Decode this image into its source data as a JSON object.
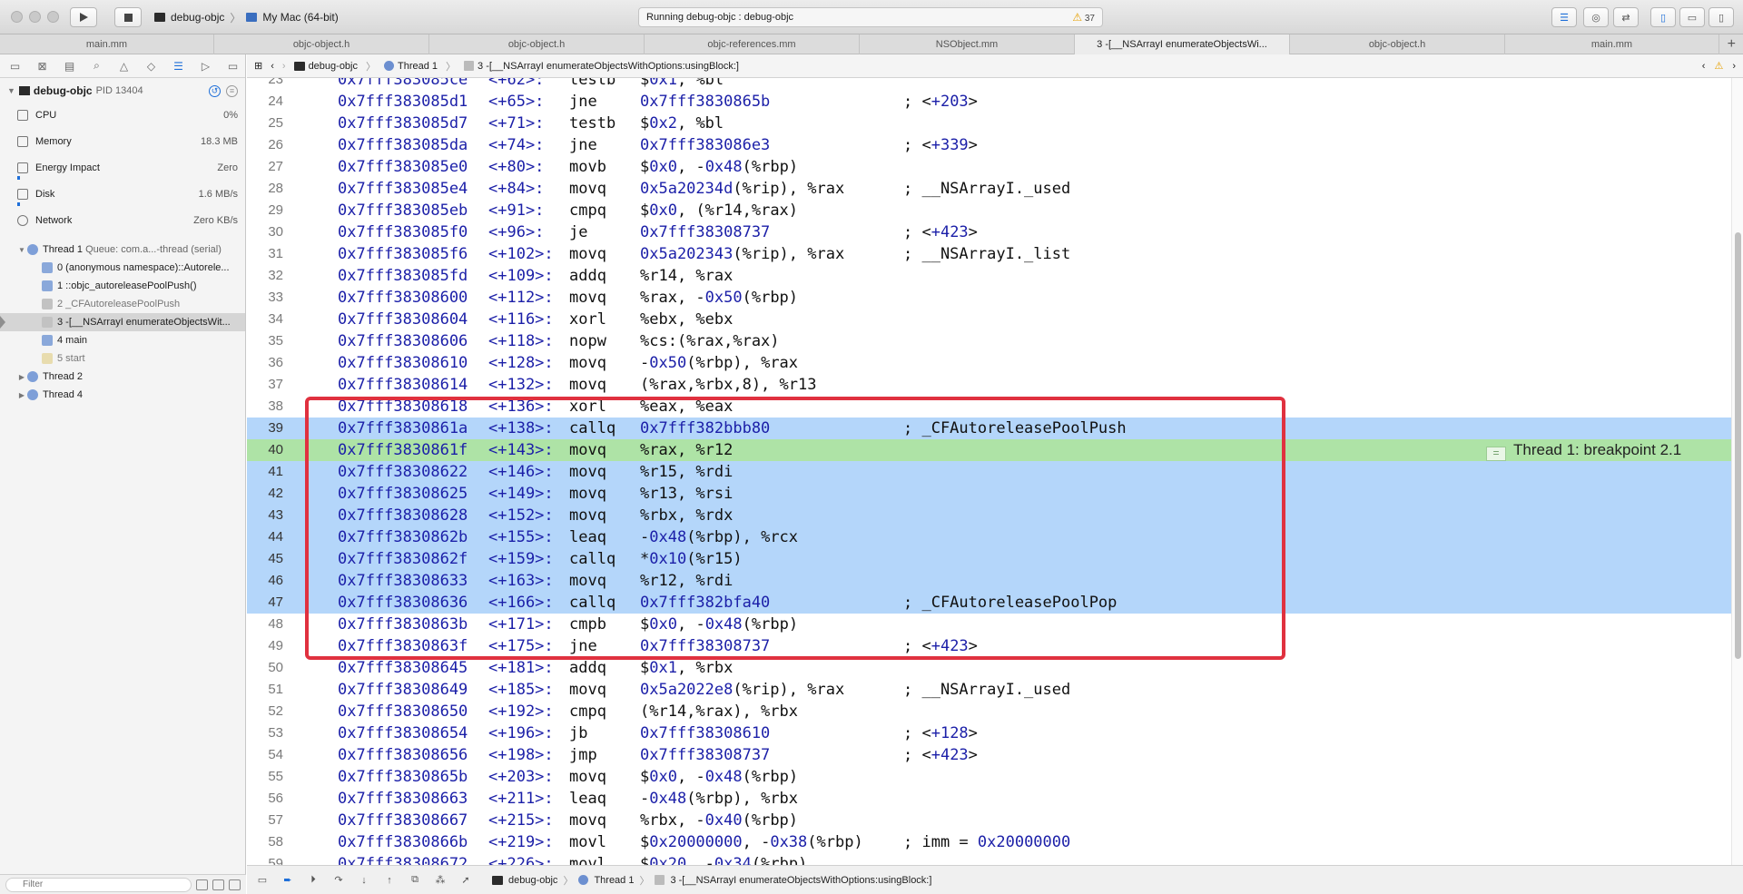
{
  "toolbar": {
    "scheme_target": "debug-objc",
    "destination": "My Mac (64-bit)",
    "status_text": "Running debug-objc : debug-objc",
    "warning_count": "37"
  },
  "tabs": [
    {
      "label": "main.mm"
    },
    {
      "label": "objc-object.h"
    },
    {
      "label": "objc-object.h"
    },
    {
      "label": "objc-references.mm"
    },
    {
      "label": "NSObject.mm"
    },
    {
      "label": "3 -[__NSArrayI enumerateObjectsWi..."
    },
    {
      "label": "objc-object.h"
    },
    {
      "label": "main.mm"
    }
  ],
  "tab_add": "+",
  "navigator": {
    "process_name": "debug-objc",
    "pid": "PID 13404",
    "gauges": [
      {
        "name": "CPU",
        "value": "0%"
      },
      {
        "name": "Memory",
        "value": "18.3 MB"
      },
      {
        "name": "Energy Impact",
        "value": "Zero"
      },
      {
        "name": "Disk",
        "value": "1.6 MB/s"
      },
      {
        "name": "Network",
        "value": "Zero KB/s"
      }
    ],
    "thread1": "Thread 1",
    "thread1_queue": "Queue: com.a...-thread (serial)",
    "frames": [
      {
        "label": "0 (anonymous namespace)::Autorele..."
      },
      {
        "label": "1 ::objc_autoreleasePoolPush()"
      },
      {
        "label": "2 _CFAutoreleasePoolPush"
      },
      {
        "label": "3 -[__NSArrayI enumerateObjectsWit..."
      },
      {
        "label": "4 main"
      },
      {
        "label": "5 start"
      }
    ],
    "thread2": "Thread 2",
    "thread4": "Thread 4",
    "filter_placeholder": "Filter"
  },
  "jumpbar": {
    "project": "debug-objc",
    "thread": "Thread 1",
    "frame": "3 -[__NSArrayI enumerateObjectsWithOptions:usingBlock:]"
  },
  "disassembly": [
    {
      "ln": "23",
      "addr": "0x7fff383085ce",
      "off": "<+62>:",
      "mn": "testb",
      "ops": "$0x1, %bl",
      "cmt": ""
    },
    {
      "ln": "24",
      "addr": "0x7fff383085d1",
      "off": "<+65>:",
      "mn": "jne",
      "ops": "0x7fff3830865b",
      "cmt": "; <+203>"
    },
    {
      "ln": "25",
      "addr": "0x7fff383085d7",
      "off": "<+71>:",
      "mn": "testb",
      "ops": "$0x2, %bl",
      "cmt": ""
    },
    {
      "ln": "26",
      "addr": "0x7fff383085da",
      "off": "<+74>:",
      "mn": "jne",
      "ops": "0x7fff383086e3",
      "cmt": "; <+339>"
    },
    {
      "ln": "27",
      "addr": "0x7fff383085e0",
      "off": "<+80>:",
      "mn": "movb",
      "ops": "$0x0, -0x48(%rbp)",
      "cmt": ""
    },
    {
      "ln": "28",
      "addr": "0x7fff383085e4",
      "off": "<+84>:",
      "mn": "movq",
      "ops": "0x5a20234d(%rip), %rax",
      "cmt": "; __NSArrayI._used"
    },
    {
      "ln": "29",
      "addr": "0x7fff383085eb",
      "off": "<+91>:",
      "mn": "cmpq",
      "ops": "$0x0, (%r14,%rax)",
      "cmt": ""
    },
    {
      "ln": "30",
      "addr": "0x7fff383085f0",
      "off": "<+96>:",
      "mn": "je",
      "ops": "0x7fff38308737",
      "cmt": "; <+423>"
    },
    {
      "ln": "31",
      "addr": "0x7fff383085f6",
      "off": "<+102>:",
      "mn": "movq",
      "ops": "0x5a202343(%rip), %rax",
      "cmt": "; __NSArrayI._list"
    },
    {
      "ln": "32",
      "addr": "0x7fff383085fd",
      "off": "<+109>:",
      "mn": "addq",
      "ops": "%r14, %rax",
      "cmt": ""
    },
    {
      "ln": "33",
      "addr": "0x7fff38308600",
      "off": "<+112>:",
      "mn": "movq",
      "ops": "%rax, -0x50(%rbp)",
      "cmt": ""
    },
    {
      "ln": "34",
      "addr": "0x7fff38308604",
      "off": "<+116>:",
      "mn": "xorl",
      "ops": "%ebx, %ebx",
      "cmt": ""
    },
    {
      "ln": "35",
      "addr": "0x7fff38308606",
      "off": "<+118>:",
      "mn": "nopw",
      "ops": "%cs:(%rax,%rax)",
      "cmt": ""
    },
    {
      "ln": "36",
      "addr": "0x7fff38308610",
      "off": "<+128>:",
      "mn": "movq",
      "ops": "-0x50(%rbp), %rax",
      "cmt": ""
    },
    {
      "ln": "37",
      "addr": "0x7fff38308614",
      "off": "<+132>:",
      "mn": "movq",
      "ops": "(%rax,%rbx,8), %r13",
      "cmt": ""
    },
    {
      "ln": "38",
      "addr": "0x7fff38308618",
      "off": "<+136>:",
      "mn": "xorl",
      "ops": "%eax, %eax",
      "cmt": ""
    },
    {
      "ln": "39",
      "addr": "0x7fff3830861a",
      "off": "<+138>:",
      "mn": "callq",
      "ops": "0x7fff382bbb80",
      "cmt": "; _CFAutoreleasePoolPush"
    },
    {
      "ln": "40",
      "addr": "0x7fff3830861f",
      "off": "<+143>:",
      "mn": "movq",
      "ops": "%rax, %r12",
      "cmt": ""
    },
    {
      "ln": "41",
      "addr": "0x7fff38308622",
      "off": "<+146>:",
      "mn": "movq",
      "ops": "%r15, %rdi",
      "cmt": ""
    },
    {
      "ln": "42",
      "addr": "0x7fff38308625",
      "off": "<+149>:",
      "mn": "movq",
      "ops": "%r13, %rsi",
      "cmt": ""
    },
    {
      "ln": "43",
      "addr": "0x7fff38308628",
      "off": "<+152>:",
      "mn": "movq",
      "ops": "%rbx, %rdx",
      "cmt": ""
    },
    {
      "ln": "44",
      "addr": "0x7fff3830862b",
      "off": "<+155>:",
      "mn": "leaq",
      "ops": "-0x48(%rbp), %rcx",
      "cmt": ""
    },
    {
      "ln": "45",
      "addr": "0x7fff3830862f",
      "off": "<+159>:",
      "mn": "callq",
      "ops": "*0x10(%r15)",
      "cmt": ""
    },
    {
      "ln": "46",
      "addr": "0x7fff38308633",
      "off": "<+163>:",
      "mn": "movq",
      "ops": "%r12, %rdi",
      "cmt": ""
    },
    {
      "ln": "47",
      "addr": "0x7fff38308636",
      "off": "<+166>:",
      "mn": "callq",
      "ops": "0x7fff382bfa40",
      "cmt": "; _CFAutoreleasePoolPop"
    },
    {
      "ln": "48",
      "addr": "0x7fff3830863b",
      "off": "<+171>:",
      "mn": "cmpb",
      "ops": "$0x0, -0x48(%rbp)",
      "cmt": ""
    },
    {
      "ln": "49",
      "addr": "0x7fff3830863f",
      "off": "<+175>:",
      "mn": "jne",
      "ops": "0x7fff38308737",
      "cmt": "; <+423>"
    },
    {
      "ln": "50",
      "addr": "0x7fff38308645",
      "off": "<+181>:",
      "mn": "addq",
      "ops": "$0x1, %rbx",
      "cmt": ""
    },
    {
      "ln": "51",
      "addr": "0x7fff38308649",
      "off": "<+185>:",
      "mn": "movq",
      "ops": "0x5a2022e8(%rip), %rax",
      "cmt": "; __NSArrayI._used"
    },
    {
      "ln": "52",
      "addr": "0x7fff38308650",
      "off": "<+192>:",
      "mn": "cmpq",
      "ops": "(%r14,%rax), %rbx",
      "cmt": ""
    },
    {
      "ln": "53",
      "addr": "0x7fff38308654",
      "off": "<+196>:",
      "mn": "jb",
      "ops": "0x7fff38308610",
      "cmt": "; <+128>"
    },
    {
      "ln": "54",
      "addr": "0x7fff38308656",
      "off": "<+198>:",
      "mn": "jmp",
      "ops": "0x7fff38308737",
      "cmt": "; <+423>"
    },
    {
      "ln": "55",
      "addr": "0x7fff3830865b",
      "off": "<+203>:",
      "mn": "movq",
      "ops": "$0x0, -0x48(%rbp)",
      "cmt": ""
    },
    {
      "ln": "56",
      "addr": "0x7fff38308663",
      "off": "<+211>:",
      "mn": "leaq",
      "ops": "-0x48(%rbp), %rbx",
      "cmt": ""
    },
    {
      "ln": "57",
      "addr": "0x7fff38308667",
      "off": "<+215>:",
      "mn": "movq",
      "ops": "%rbx, -0x40(%rbp)",
      "cmt": ""
    },
    {
      "ln": "58",
      "addr": "0x7fff3830866b",
      "off": "<+219>:",
      "mn": "movl",
      "ops": "$0x20000000, -0x38(%rbp)",
      "cmt": "; imm = 0x20000000"
    },
    {
      "ln": "59",
      "addr": "0x7fff38308672",
      "off": "<+226>:",
      "mn": "movl",
      "ops": "$0x20, -0x34(%rbp)",
      "cmt": ""
    }
  ],
  "breakpoint_label": "Thread 1: breakpoint 2.1",
  "debugbar": {
    "project": "debug-objc",
    "thread": "Thread 1",
    "frame": "3 -[__NSArrayI enumerateObjectsWithOptions:usingBlock:]"
  },
  "colors": {
    "selection": "#b4d6fa",
    "pc_line": "#aee3a6",
    "annotation_box": "#e0313f",
    "address": "#1b1fa8"
  }
}
